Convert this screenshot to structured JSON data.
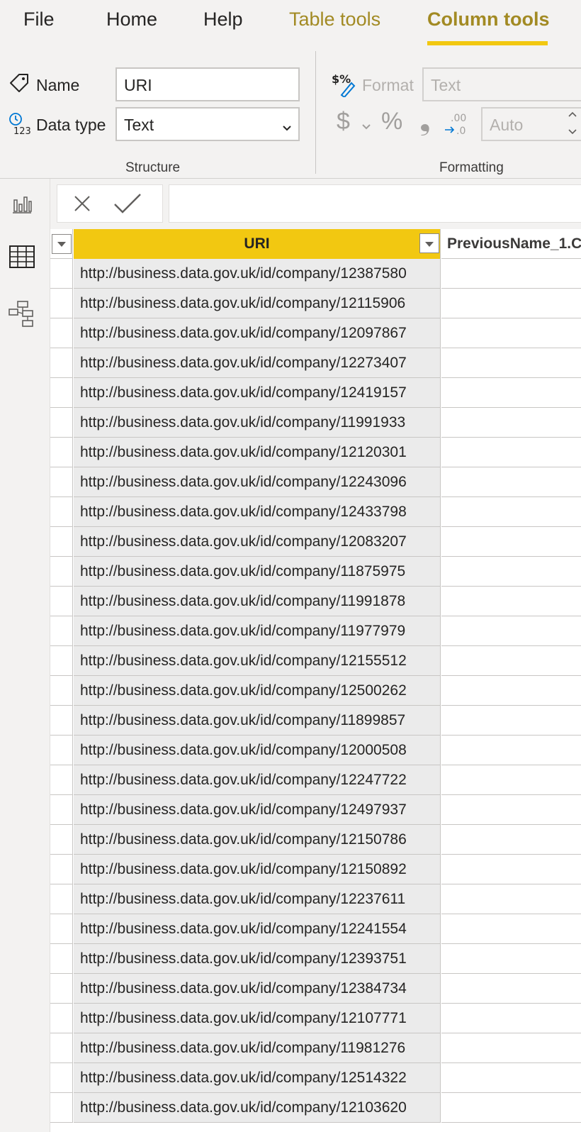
{
  "ribbon": {
    "tabs": [
      {
        "label": "File"
      },
      {
        "label": "Home"
      },
      {
        "label": "Help"
      },
      {
        "label": "Table tools"
      },
      {
        "label": "Column tools"
      }
    ],
    "active_tab": "Column tools",
    "structure": {
      "name_label": "Name",
      "name_value": "URI",
      "datatype_label": "Data type",
      "datatype_value": "Text",
      "group_label": "Structure"
    },
    "formatting": {
      "format_label": "Format",
      "format_value": "Text",
      "decimal_value": "Auto",
      "group_label": "Formatting",
      "currency_symbol": "$",
      "percent_symbol": "%",
      "comma_symbol": "❟",
      "decimals_symbol": ".00",
      "decimals_to": ".0"
    }
  },
  "grid": {
    "columns": [
      {
        "header": "URI",
        "selected": true
      },
      {
        "header": "PreviousName_1.C"
      }
    ],
    "rows": [
      "http://business.data.gov.uk/id/company/12387580",
      "http://business.data.gov.uk/id/company/12115906",
      "http://business.data.gov.uk/id/company/12097867",
      "http://business.data.gov.uk/id/company/12273407",
      "http://business.data.gov.uk/id/company/12419157",
      "http://business.data.gov.uk/id/company/11991933",
      "http://business.data.gov.uk/id/company/12120301",
      "http://business.data.gov.uk/id/company/12243096",
      "http://business.data.gov.uk/id/company/12433798",
      "http://business.data.gov.uk/id/company/12083207",
      "http://business.data.gov.uk/id/company/11875975",
      "http://business.data.gov.uk/id/company/11991878",
      "http://business.data.gov.uk/id/company/11977979",
      "http://business.data.gov.uk/id/company/12155512",
      "http://business.data.gov.uk/id/company/12500262",
      "http://business.data.gov.uk/id/company/11899857",
      "http://business.data.gov.uk/id/company/12000508",
      "http://business.data.gov.uk/id/company/12247722",
      "http://business.data.gov.uk/id/company/12497937",
      "http://business.data.gov.uk/id/company/12150786",
      "http://business.data.gov.uk/id/company/12150892",
      "http://business.data.gov.uk/id/company/12237611",
      "http://business.data.gov.uk/id/company/12241554",
      "http://business.data.gov.uk/id/company/12393751",
      "http://business.data.gov.uk/id/company/12384734",
      "http://business.data.gov.uk/id/company/12107771",
      "http://business.data.gov.uk/id/company/11981276",
      "http://business.data.gov.uk/id/company/12514322",
      "http://business.data.gov.uk/id/company/12103620"
    ]
  },
  "colors": {
    "accent": "#f2c811",
    "context_tab": "#a28a23",
    "selected_cell": "#ebebeb"
  },
  "icons": {
    "name": "tag-icon",
    "datatype": "datatype-123-icon",
    "format": "format-paint-icon",
    "cancel": "close-icon",
    "commit": "check-icon",
    "report_view": "report-view-icon",
    "data_view": "data-view-icon",
    "model_view": "model-view-icon"
  }
}
